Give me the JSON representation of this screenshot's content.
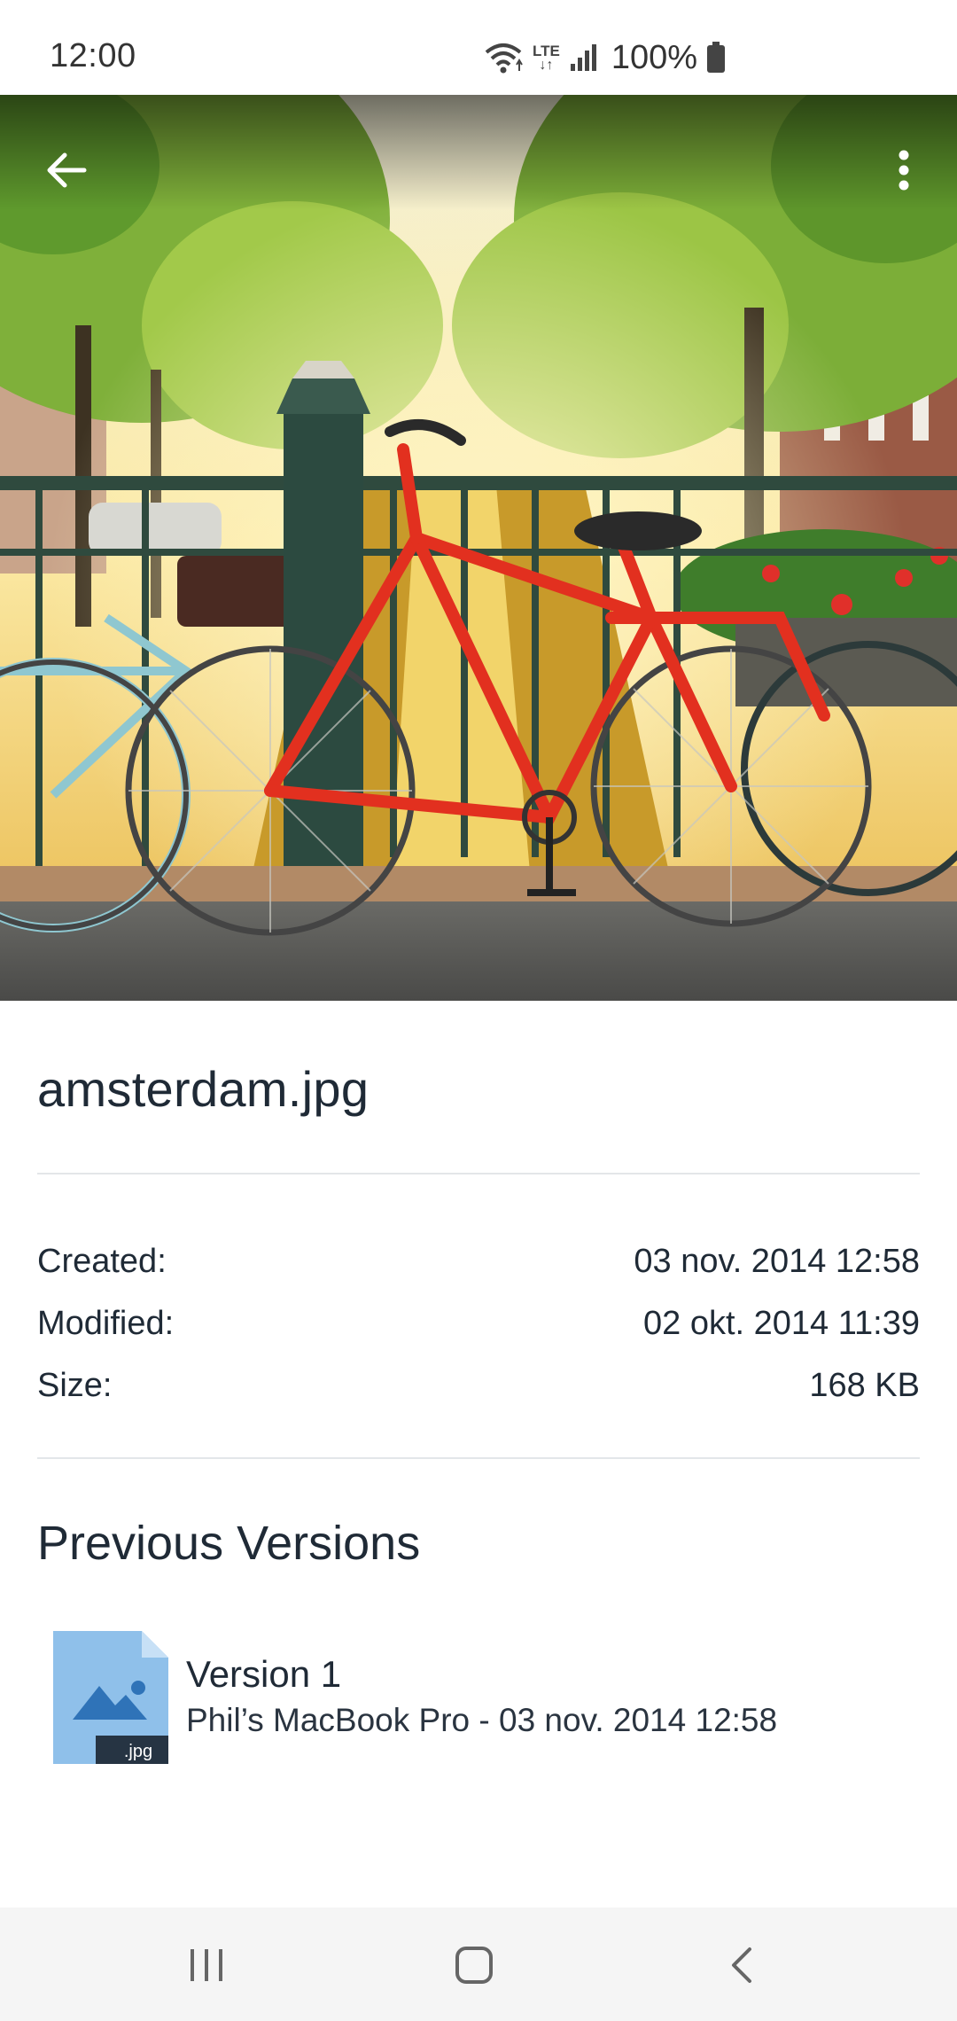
{
  "status_bar": {
    "time": "12:00",
    "network": "LTE",
    "battery": "100%"
  },
  "toolbar": {
    "back_icon": "arrow-left-icon",
    "more_icon": "more-vertical-icon"
  },
  "file": {
    "name": "amsterdam.jpg",
    "details": [
      {
        "label": "Created:",
        "value": "03 nov. 2014 12:58"
      },
      {
        "label": "Modified:",
        "value": "02 okt. 2014 11:39"
      },
      {
        "label": "Size:",
        "value": "168 KB"
      }
    ]
  },
  "versions": {
    "title": "Previous Versions",
    "items": [
      {
        "title": "Version 1",
        "subtitle": "Phil’s MacBook Pro - 03 nov. 2014 12:58",
        "ext": ".jpg",
        "icon": "image-file-icon"
      }
    ]
  },
  "nav": {
    "recents_icon": "recents-icon",
    "home_icon": "home-icon",
    "back_icon": "back-chevron-icon"
  },
  "colors": {
    "text": "#1f2a36",
    "divider": "#e3e6e9",
    "file_icon": "#8fc0ea",
    "file_icon_dark": "#2f73b8",
    "badge": "#263443",
    "nav_bg": "#f5f5f5"
  }
}
